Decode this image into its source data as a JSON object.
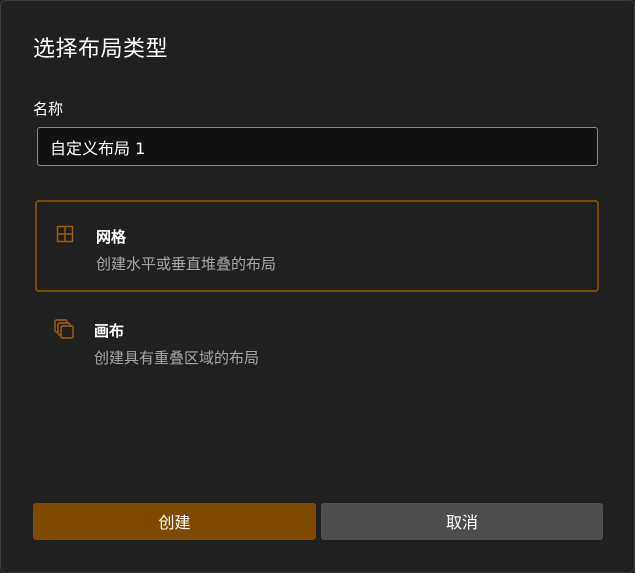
{
  "dialog": {
    "title": "选择布局类型",
    "name_label": "名称",
    "name_value": "自定义布局 1"
  },
  "options": [
    {
      "title": "网格",
      "description": "创建水平或垂直堆叠的布局",
      "icon": "grid-icon",
      "selected": true
    },
    {
      "title": "画布",
      "description": "创建具有重叠区域的布局",
      "icon": "canvas-icon",
      "selected": false
    }
  ],
  "buttons": {
    "create": "创建",
    "cancel": "取消"
  },
  "colors": {
    "accent": "#7f4a00",
    "accent_border": "#7a4a06",
    "background": "#202020",
    "secondary_button": "#4e4e4e"
  }
}
